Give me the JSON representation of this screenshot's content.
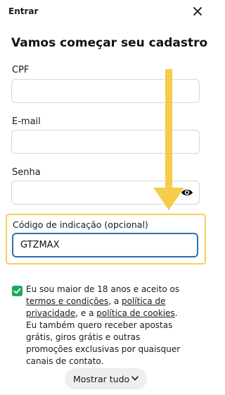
{
  "header": {
    "title": "Entrar",
    "close_icon": "close-icon"
  },
  "page_title": "Vamos começar seu cadastro",
  "fields": {
    "cpf": {
      "label": "CPF",
      "value": ""
    },
    "email": {
      "label": "E-mail",
      "value": ""
    },
    "password": {
      "label": "Senha",
      "value": "",
      "toggle_icon": "eye-icon"
    },
    "referral": {
      "label": "Código de indicação (opcional)",
      "value": "GTZMAX"
    }
  },
  "consent": {
    "checked": true,
    "text_1": "Eu sou maior de 18 anos e aceito os ",
    "link_terms": "termos e condições",
    "text_2": ", a ",
    "link_privacy": "política de privacidade",
    "text_3": ", e a ",
    "link_cookies": "política de cookies",
    "text_4": ". Eu também quero receber apostas grátis, giros grátis e outras promoções exclusivas por quaisquer canais de contato."
  },
  "show_all": {
    "label": "Mostrar tudo",
    "icon": "chevron-down-icon"
  },
  "colors": {
    "accent_green": "#1fa85f",
    "highlight_yellow": "#f5d05a",
    "arrow_yellow": "#f4cd4a",
    "focus_blue": "#2b73a8"
  }
}
